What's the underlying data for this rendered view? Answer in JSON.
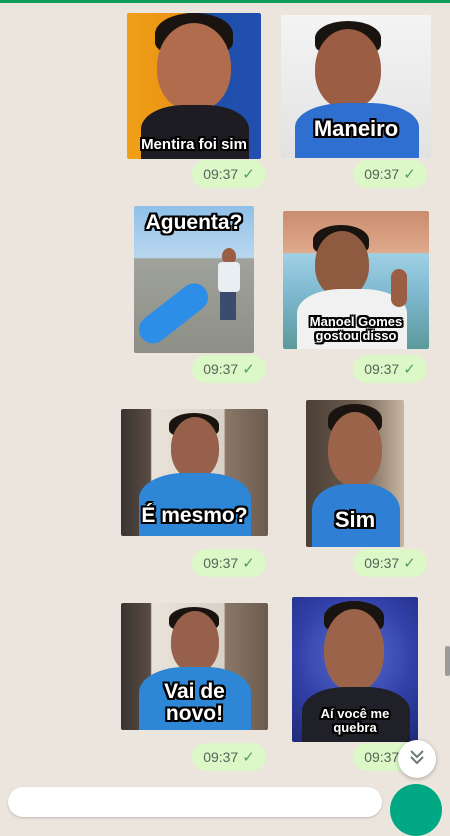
{
  "chat": {
    "messages": [
      {
        "caption": "Mentira foi sim",
        "time": "09:37"
      },
      {
        "caption": "Maneiro",
        "time": "09:37"
      },
      {
        "caption": "Aguenta?",
        "time": "09:37"
      },
      {
        "caption": "Manoel Gomes gostou disso",
        "time": "09:37"
      },
      {
        "caption": "É mesmo?",
        "time": "09:37"
      },
      {
        "caption": "Sim",
        "time": "09:37"
      },
      {
        "caption": "Vai de novo!",
        "time": "09:37"
      },
      {
        "caption": "Aí você me quebra",
        "time": "09:37"
      }
    ]
  },
  "icons": {
    "read_receipt": "check-icon",
    "scroll_down": "chevron-double-down-icon",
    "send": "mic-icon"
  },
  "colors": {
    "background": "#ece5dd",
    "bubble": "#dcf8c6",
    "accent": "#00a884"
  }
}
